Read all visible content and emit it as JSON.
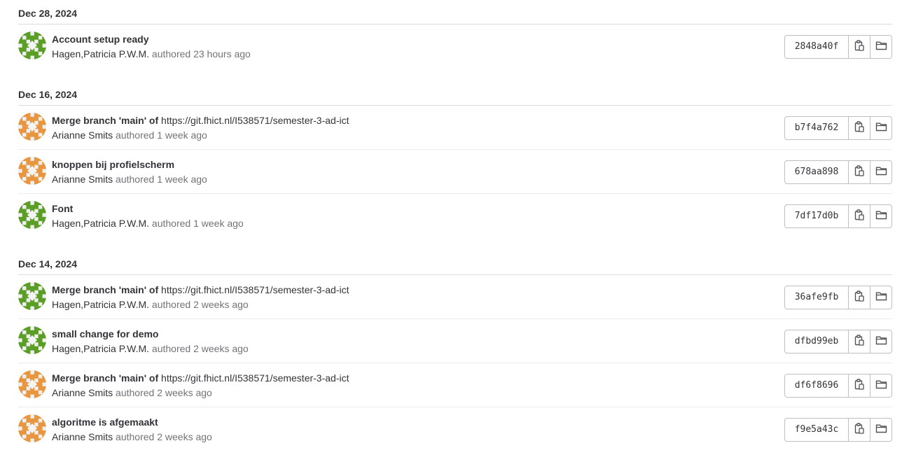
{
  "groups": [
    {
      "date": "Dec 28, 2024",
      "commits": [
        {
          "title": "Account setup ready",
          "title_rest": "",
          "author": "Hagen,Patricia P.W.M.",
          "authored": "authored 23 hours ago",
          "sha": "2848a40f",
          "avatar_color": "#5a9e25"
        }
      ]
    },
    {
      "date": "Dec 16, 2024",
      "commits": [
        {
          "title": "Merge branch 'main' of",
          "title_rest": " https://git.fhict.nl/I538571/semester-3-ad-ict",
          "author": "Arianne Smits",
          "authored": "authored 1 week ago",
          "sha": "b7f4a762",
          "avatar_color": "#e8963f"
        },
        {
          "title": "knoppen bij profielscherm",
          "title_rest": "",
          "author": "Arianne Smits",
          "authored": "authored 1 week ago",
          "sha": "678aa898",
          "avatar_color": "#e8963f"
        },
        {
          "title": "Font",
          "title_rest": "",
          "author": "Hagen,Patricia P.W.M.",
          "authored": "authored 1 week ago",
          "sha": "7df17d0b",
          "avatar_color": "#5a9e25"
        }
      ]
    },
    {
      "date": "Dec 14, 2024",
      "commits": [
        {
          "title": "Merge branch 'main' of",
          "title_rest": " https://git.fhict.nl/I538571/semester-3-ad-ict",
          "author": "Hagen,Patricia P.W.M.",
          "authored": "authored 2 weeks ago",
          "sha": "36afe9fb",
          "avatar_color": "#5a9e25"
        },
        {
          "title": "small change for demo",
          "title_rest": "",
          "author": "Hagen,Patricia P.W.M.",
          "authored": "authored 2 weeks ago",
          "sha": "dfbd99eb",
          "avatar_color": "#5a9e25"
        },
        {
          "title": "Merge branch 'main' of",
          "title_rest": " https://git.fhict.nl/I538571/semester-3-ad-ict",
          "author": "Arianne Smits",
          "authored": "authored 2 weeks ago",
          "sha": "df6f8696",
          "avatar_color": "#e8963f"
        },
        {
          "title": "algoritme is afgemaakt",
          "title_rest": "",
          "author": "Arianne Smits",
          "authored": "authored 2 weeks ago",
          "sha": "f9e5a43c",
          "avatar_color": "#e8963f"
        }
      ]
    }
  ],
  "icons": {
    "copy": "copy-icon",
    "browse": "folder-icon"
  }
}
